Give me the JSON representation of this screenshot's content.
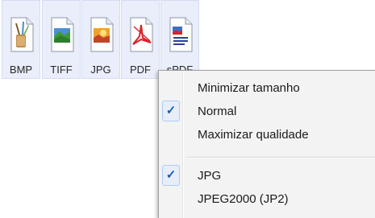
{
  "formats": [
    {
      "label": "BMP",
      "icon": "bmp-file-icon"
    },
    {
      "label": "TIFF",
      "icon": "tiff-file-icon"
    },
    {
      "label": "JPG",
      "icon": "jpg-file-icon"
    },
    {
      "label": "PDF",
      "icon": "pdf-file-icon"
    },
    {
      "label": "sPDF",
      "icon": "spdf-file-icon"
    }
  ],
  "menu": {
    "items": [
      {
        "label": "Minimizar tamanho",
        "checked": false
      },
      {
        "label": "Normal",
        "checked": true
      },
      {
        "label": "Maximizar qualidade",
        "checked": false
      },
      {
        "label": "JPG",
        "checked": true
      },
      {
        "label": "JPEG2000 (JP2)",
        "checked": false
      }
    ],
    "check_glyph": "✓"
  },
  "colors": {
    "active_tile": "#eaeefa",
    "check_highlight": "#e7eef9",
    "check_mark": "#1e5bb5"
  }
}
